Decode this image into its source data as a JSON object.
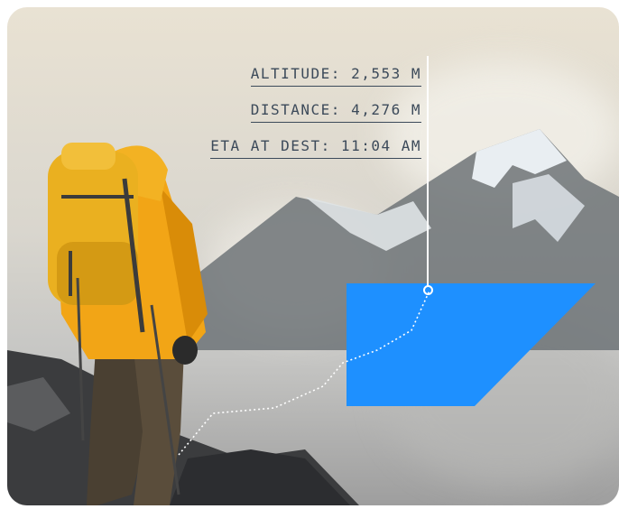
{
  "stats": {
    "altitude": "ALTITUDE: 2,553 M",
    "distance": "DISTANCE: 4,276 M",
    "eta": "ETA AT DEST: 11:04 AM"
  },
  "colors": {
    "accent_blue": "#1e90ff",
    "label_text": "#3c4a5a",
    "jacket": "#f2a516",
    "backpack": "#eab020"
  },
  "icons": {
    "marker": "location-marker-icon"
  }
}
